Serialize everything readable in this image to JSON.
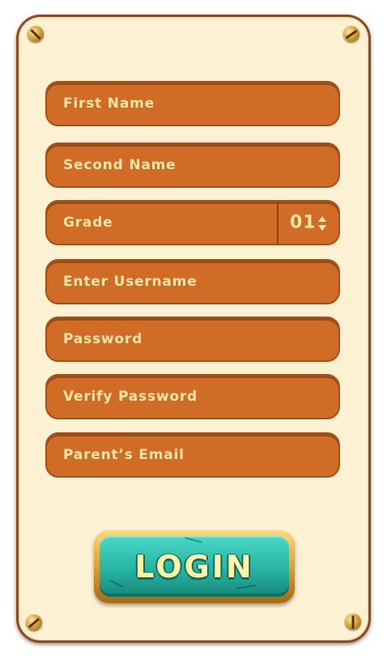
{
  "form": {
    "fields": [
      {
        "placeholder": "First Name"
      },
      {
        "placeholder": "Second Name"
      },
      {
        "placeholder": "Grade",
        "value": "01"
      },
      {
        "placeholder": "Enter Username"
      },
      {
        "placeholder": "Password"
      },
      {
        "placeholder": "Verify Password"
      },
      {
        "placeholder": "Parent’s Email"
      }
    ]
  },
  "login": {
    "label": "LOGIN"
  },
  "colors": {
    "panel_background": "#fdf1d3",
    "field_background": "#d06c26",
    "field_text": "#fde7a8",
    "button_teal": "#27b4a3",
    "button_gold": "#e3a636"
  },
  "icons": [
    "screw-icon",
    "stepper-arrows-icon"
  ]
}
